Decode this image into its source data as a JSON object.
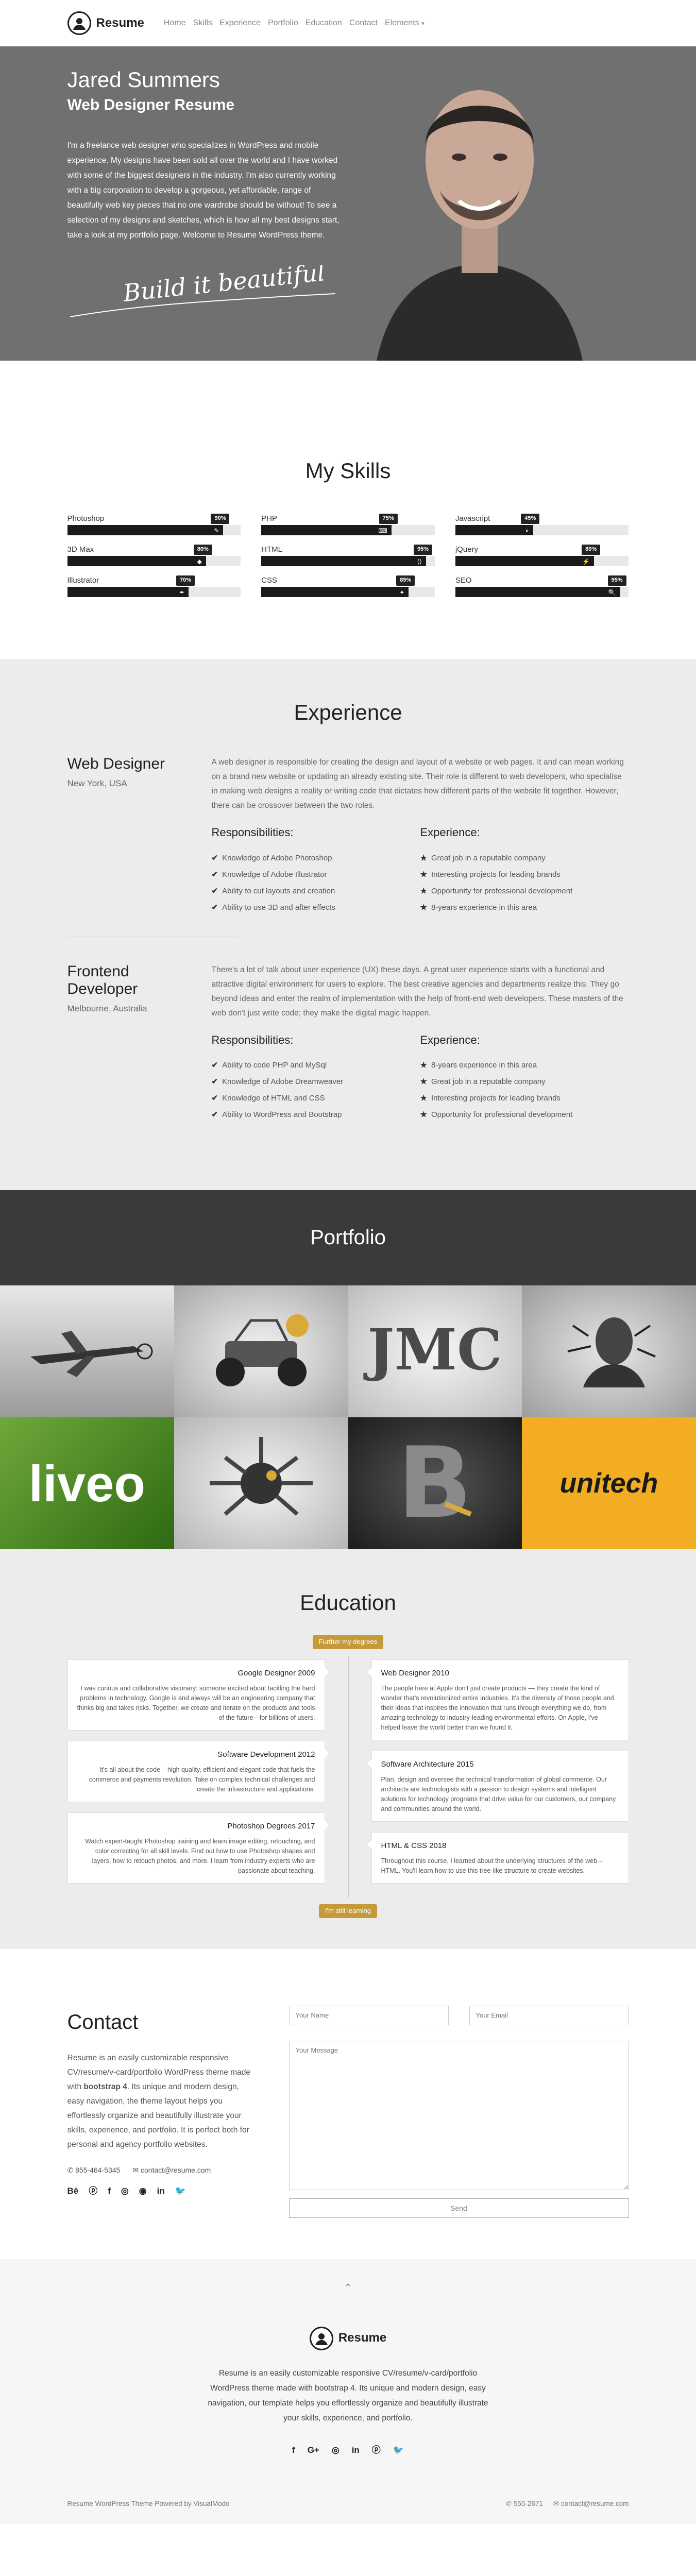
{
  "nav": {
    "brand": "Resume",
    "items": [
      "Home",
      "Skills",
      "Experience",
      "Portfolio",
      "Education",
      "Contact",
      "Elements"
    ]
  },
  "hero": {
    "name": "Jared Summers",
    "role": "Web Designer Resume",
    "bio": "I'm a freelance web designer who specializes in WordPress and mobile experience. My designs have been sold all over the world and I have worked with some of the biggest designers in the industry. I'm also currently working with a big corporation to develop a gorgeous, yet affordable, range of beautifully web key pieces that no one wardrobe should be without! To see a selection of my designs and sketches, which is how all my best designs start, take a look at my portfolio page. Welcome to Resume WordPress theme.",
    "signature": "Build it beautiful"
  },
  "skills": {
    "title": "My Skills",
    "items": [
      {
        "name": "Photoshop",
        "pct": "90%",
        "value": 90
      },
      {
        "name": "PHP",
        "pct": "75%",
        "value": 75
      },
      {
        "name": "Javascript",
        "pct": "45%",
        "value": 45
      },
      {
        "name": "3D Max",
        "pct": "80%",
        "value": 80
      },
      {
        "name": "HTML",
        "pct": "95%",
        "value": 95
      },
      {
        "name": "jQuery",
        "pct": "80%",
        "value": 80
      },
      {
        "name": "Illustrator",
        "pct": "70%",
        "value": 70
      },
      {
        "name": "CSS",
        "pct": "85%",
        "value": 85
      },
      {
        "name": "SEO",
        "pct": "95%",
        "value": 95
      }
    ]
  },
  "experience": {
    "title": "Experience",
    "jobs": [
      {
        "title": "Web Designer",
        "location": "New York, USA",
        "description": "A web designer is responsible for creating the design and layout of a website or web pages. It and can mean working on a brand new website or updating an already existing site. Their role is different to web developers, who specialise in making web designs a reality or writing code that dictates how different parts of the website fit together. However, there can be crossover between the two roles.",
        "resp_title": "Responsibilities:",
        "responsibilities": [
          "Knowledge of Adobe Photoshop",
          "Knowledge of Adobe Illustrator",
          "Ability to cut layouts and creation",
          "Ability to use 3D and after effects"
        ],
        "exp_title": "Experience:",
        "experience": [
          "Great job in a reputable company",
          "Interesting projects for leading brands",
          "Opportunity for professional development",
          "8-years experience in this area"
        ]
      },
      {
        "title": "Frontend Developer",
        "location": "Melbourne, Australia",
        "description": "There's a lot of talk about user experience (UX) these days. A great user experience starts with a functional and attractive digital environment for users to explore. The best creative agencies and departments realize this. They go beyond ideas and enter the realm of implementation with the help of front-end web developers. These masters of the web don't just write code; they make the digital magic happen.",
        "resp_title": "Responsibilities:",
        "responsibilities": [
          "Ability to code PHP and MySql",
          "Knowledge of Adobe Dreamweaver",
          "Knowledge of HTML and CSS",
          "Ability to WordPress and Bootstrap"
        ],
        "exp_title": "Experience:",
        "experience": [
          "8-years experience in this area",
          "Great job in a reputable company",
          "Interesting projects for leading brands",
          "Opportunity for professional development"
        ]
      }
    ]
  },
  "portfolio": {
    "title": "Portfolio",
    "tiles": [
      "plane",
      "buggy",
      "JMC",
      "splash",
      "liveo",
      "explosion",
      "B",
      "unitech"
    ]
  },
  "education": {
    "title": "Education",
    "start_tag": "Further my degrees",
    "end_tag": "I'm still learning",
    "left": [
      {
        "title": "Google Designer 2009",
        "text": "I was curious and collaborative visionary: someone excited about tackling the hard problems in technology. Google is and always will be an engineering company that thinks big and takes risks. Together, we create and iterate on the products and tools of the future—for billions of users."
      },
      {
        "title": "Software Development 2012",
        "text": "It's all about the code – high quality, efficient and elegant code that fuels the commerce and payments revolution. Take on complex technical challenges and create the infrastructure and applications."
      },
      {
        "title": "Photoshop Degrees 2017",
        "text": "Watch expert-taught Photoshop training and learn image editing, retouching, and color correcting for all skill levels. Find out how to use Photoshop shapes and layers, how to retouch photos, and more. I learn from industry experts who are passionate about teaching."
      }
    ],
    "right": [
      {
        "title": "Web Designer 2010",
        "text": "The people here at Apple don't just create products — they create the kind of wonder that's revolutionized entire industries. It's the diversity of those people and their ideas that inspires the innovation that runs through everything we do, from amazing technology to industry-leading environmental efforts. On Apple, I've helped leave the world better than we found it."
      },
      {
        "title": "Software Architecture 2015",
        "text": "Plan, design and oversee the technical transformation of global commerce. Our architects are technologists with a passion to design systems and intelligent solutions for technology programs that drive value for our customers, our company and communities around the world."
      },
      {
        "title": "HTML & CSS 2018",
        "text": "Throughout this course, I learned about the underlying structures of the web – HTML. You'll learn how to use this tree-like structure to create websites."
      }
    ]
  },
  "contact": {
    "title": "Contact",
    "text_before": "Resume is an easily customizable responsive CV/resume/v-card/portfolio WordPress theme made with ",
    "text_bold": "bootstrap 4",
    "text_after": ". Its unique and modern design, easy navigation, the theme layout helps you effortlessly organize and beautifully illustrate your skills, experience, and portfolio. It is perfect both for personal and agency portfolio websites.",
    "phone": "855-464-5345",
    "email": "contact@resume.com",
    "social": [
      "Bē",
      "ⓟ",
      "f",
      "◎",
      "◉",
      "in",
      "🐦"
    ],
    "name_placeholder": "Your Name",
    "email_placeholder": "Your Email",
    "message_placeholder": "Your Message",
    "send_label": "Send"
  },
  "footer": {
    "up_icon": "⌃",
    "brand": "Resume",
    "text": "Resume is an easily customizable responsive CV/resume/v-card/portfolio WordPress theme made with bootstrap 4. Its unique and modern design, easy navigation, our template helps you effortlessly organize and beautifully illustrate your skills, experience, and portfolio.",
    "social": [
      "f",
      "G+",
      "◎",
      "in",
      "ⓟ",
      "🐦"
    ],
    "credit": "Resume WordPress Theme Powered by VisualModo",
    "phone": "555-2671",
    "email": "contact@resume.com"
  }
}
